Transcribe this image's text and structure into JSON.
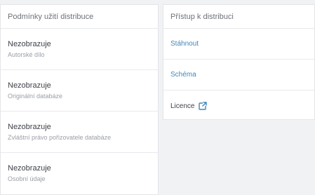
{
  "conditions": {
    "title": "Podmínky užití distribuce",
    "items": [
      {
        "status": "Nezobrazuje",
        "label": "Autorské dílo"
      },
      {
        "status": "Nezobrazuje",
        "label": "Originální databáze"
      },
      {
        "status": "Nezobrazuje",
        "label": "Zvláštní právo pořizovatele databáze"
      },
      {
        "status": "Nezobrazuje",
        "label": "Osobní údaje"
      }
    ]
  },
  "access": {
    "title": "Přístup k distribuci",
    "items": [
      {
        "label": "Stáhnout"
      },
      {
        "label": "Schéma"
      },
      {
        "label": "Licence"
      }
    ]
  },
  "colors": {
    "link": "#3f87b9",
    "icon": "#3f87b9"
  },
  "icons": {
    "external_link": "external-link-icon"
  }
}
